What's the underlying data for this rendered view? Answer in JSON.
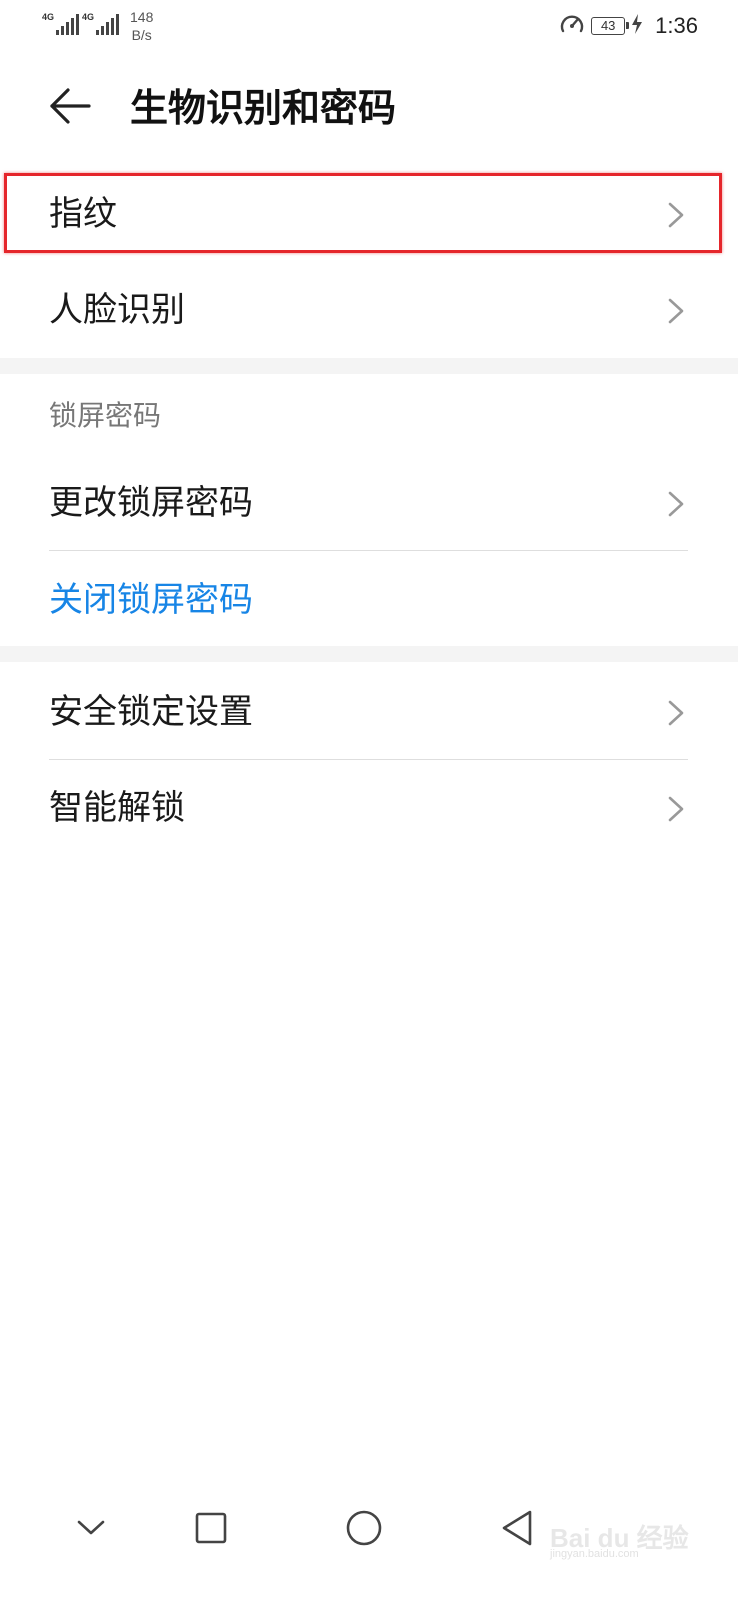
{
  "status_bar": {
    "signal_1": "4G",
    "signal_2": "4G",
    "net_speed_value": "148",
    "net_speed_unit": "B/s",
    "battery_level": "43",
    "time": "1:36"
  },
  "header": {
    "title": "生物识别和密码"
  },
  "biometrics": {
    "fingerprint_label": "指纹",
    "face_label": "人脸识别"
  },
  "lock_screen_section": {
    "header": "锁屏密码",
    "change_label": "更改锁屏密码",
    "disable_label": "关闭锁屏密码"
  },
  "other_section": {
    "security_lock_label": "安全锁定设置",
    "smart_unlock_label": "智能解锁"
  },
  "colors": {
    "accent_blue": "#1785e6",
    "highlight_red": "#e5262b"
  },
  "watermark": {
    "text": "Bai du 经验",
    "sub": "jingyan.baidu.com"
  }
}
